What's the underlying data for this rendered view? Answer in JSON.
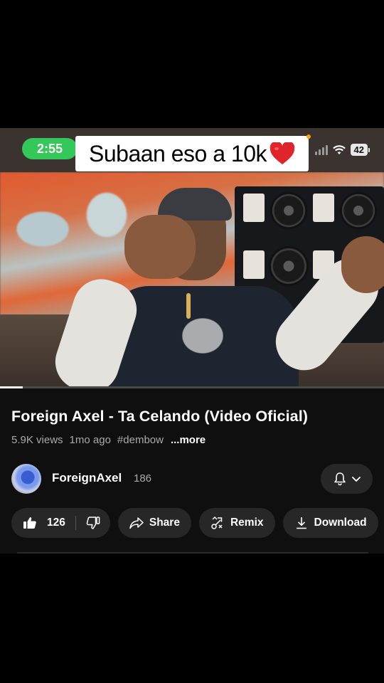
{
  "status_bar": {
    "time": "2:55",
    "battery": "42",
    "icons": [
      "signal-icon",
      "wifi-icon",
      "battery-icon"
    ]
  },
  "overlay_caption": {
    "text": "Subaan eso a 10k",
    "emoji": "❤️"
  },
  "video": {
    "progress_fraction": 0.06
  },
  "info": {
    "title": "Foreign Axel - Ta Celando (Video Oficial)",
    "views": "5.9K views",
    "age": "1mo ago",
    "hashtag": "#dembow",
    "more": "...more"
  },
  "channel": {
    "name": "ForeignAxel",
    "subscribers": "186"
  },
  "actions": {
    "likes": "126",
    "share": "Share",
    "remix": "Remix",
    "download": "Download"
  },
  "colors": {
    "time_pill": "#34c759",
    "background": "#0f0f0f",
    "pill": "#272727"
  }
}
